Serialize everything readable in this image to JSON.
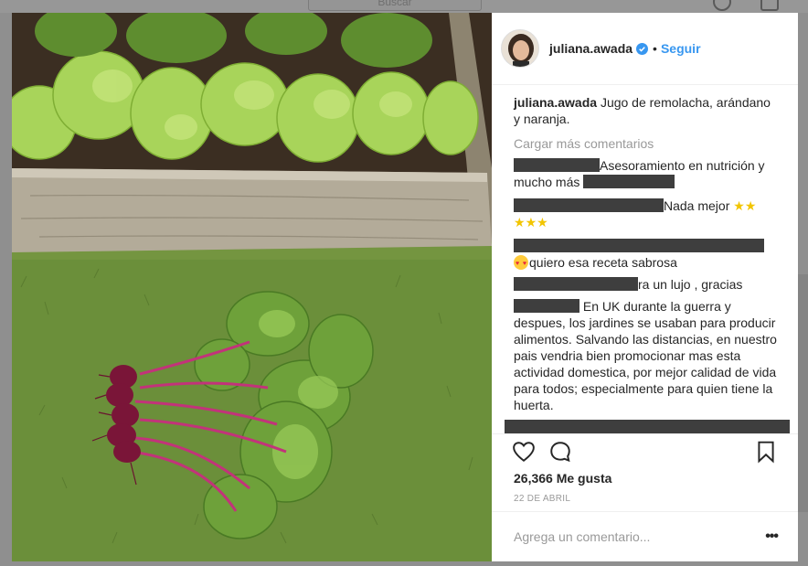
{
  "background": {
    "search_placeholder": "Buscar"
  },
  "post": {
    "username": "juliana.awada",
    "follow_label": "Seguir",
    "caption": "Jugo de remolacha, arándano y naranja.",
    "load_more_label": "Cargar más comentarios",
    "comments": [
      {
        "user": "",
        "text": "Asesoramiento en nutrición y mucho más"
      },
      {
        "user": "",
        "text": "Nada mejor"
      },
      {
        "user": "",
        "text": "quiero esa receta sabrosa"
      },
      {
        "user": "",
        "text": "ra un lujo , gracias"
      },
      {
        "user": "",
        "text": "En UK durante la guerra y despues, los jardines se usaban para producir alimentos. Salvando las distancias, en nuestro pais vendria bien promocionar mas esta actividad domestica, por mejor calidad de vida para todos; especialmente para quien tiene la huerta."
      }
    ],
    "likes": "26,366 Me gusta",
    "date": "22 DE ABRIL",
    "comment_placeholder": "Agrega un comentario...",
    "more_options": "•••"
  },
  "icons": {
    "like": "heart-icon",
    "comment": "comment-bubble-icon",
    "save": "bookmark-icon",
    "verified": "verified-badge-icon"
  },
  "colors": {
    "link": "#3897f0",
    "muted": "#999999",
    "text": "#262626",
    "verified": "#3897f0"
  }
}
